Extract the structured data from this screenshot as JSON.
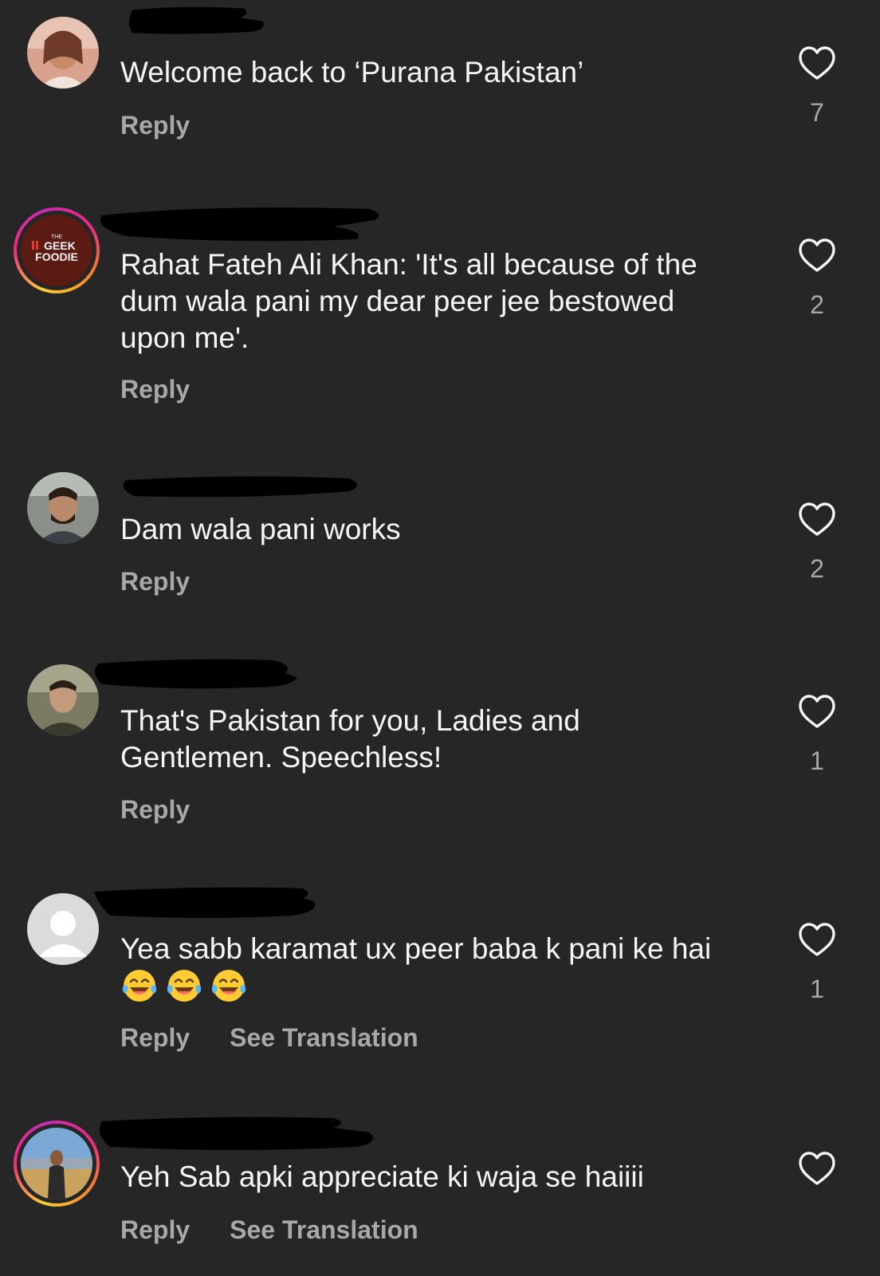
{
  "comments": [
    {
      "text": "Welcome back to ‘Purana Pakistan’",
      "reply_label": "Reply",
      "likes": "7"
    },
    {
      "text": "Rahat Fateh Ali Khan: 'It's all because of the dum wala pani my dear peer jee bestowed upon me'.",
      "reply_label": "Reply",
      "likes": "2",
      "avatar_logo_top": "THE",
      "avatar_logo_main": "GEEK",
      "avatar_logo_bottom": "FOODIE"
    },
    {
      "text": "Dam wala pani works",
      "reply_label": "Reply",
      "likes": "2"
    },
    {
      "text": "That's Pakistan for you, Ladies and Gentlemen. Speechless!",
      "reply_label": "Reply",
      "likes": "1"
    },
    {
      "text": "Yea sabb karamat ux peer baba k pani ke hai",
      "reply_label": "Reply",
      "see_translation_label": "See Translation",
      "likes": "1",
      "emoji_count": 3
    },
    {
      "text": "Yeh Sab apki appreciate ki waja se haiiii",
      "reply_label": "Reply",
      "see_translation_label": "See Translation",
      "likes": ""
    }
  ],
  "colors": {
    "background": "#262626",
    "text": "#f5f5f5",
    "secondary": "#a8a8a8",
    "story_ring": "#ee2a7b"
  }
}
